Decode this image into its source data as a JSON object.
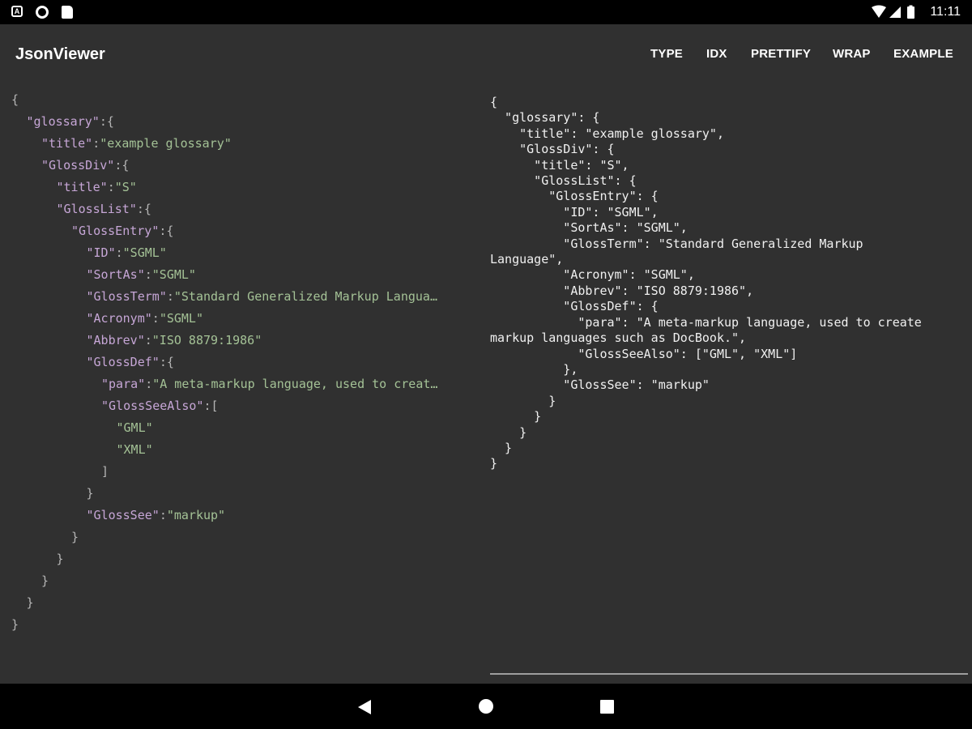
{
  "status_bar": {
    "time": "11:11",
    "left_icons": [
      "a-notification-icon",
      "circle-notification-icon",
      "sd-card-icon"
    ],
    "right_icons": [
      "wifi-icon",
      "signal-icon",
      "battery-icon"
    ]
  },
  "app_bar": {
    "title": "JsonViewer",
    "menu": [
      "TYPE",
      "IDX",
      "PRETTIFY",
      "WRAP",
      "EXAMPLE"
    ]
  },
  "tree_view": {
    "rows": [
      {
        "indent": 0,
        "segments": [
          [
            "p",
            "{"
          ]
        ]
      },
      {
        "indent": 1,
        "segments": [
          [
            "k",
            "\"glossary\""
          ],
          [
            "p",
            ":{"
          ]
        ]
      },
      {
        "indent": 2,
        "segments": [
          [
            "k",
            "\"title\""
          ],
          [
            "p",
            ":"
          ],
          [
            "v",
            "\"example glossary\""
          ]
        ]
      },
      {
        "indent": 2,
        "segments": [
          [
            "k",
            "\"GlossDiv\""
          ],
          [
            "p",
            ":{"
          ]
        ]
      },
      {
        "indent": 3,
        "segments": [
          [
            "k",
            "\"title\""
          ],
          [
            "p",
            ":"
          ],
          [
            "v",
            "\"S\""
          ]
        ]
      },
      {
        "indent": 3,
        "segments": [
          [
            "k",
            "\"GlossList\""
          ],
          [
            "p",
            ":{"
          ]
        ]
      },
      {
        "indent": 4,
        "segments": [
          [
            "k",
            "\"GlossEntry\""
          ],
          [
            "p",
            ":{"
          ]
        ]
      },
      {
        "indent": 5,
        "segments": [
          [
            "k",
            "\"ID\""
          ],
          [
            "p",
            ":"
          ],
          [
            "v",
            "\"SGML\""
          ]
        ]
      },
      {
        "indent": 5,
        "segments": [
          [
            "k",
            "\"SortAs\""
          ],
          [
            "p",
            ":"
          ],
          [
            "v",
            "\"SGML\""
          ]
        ]
      },
      {
        "indent": 5,
        "segments": [
          [
            "k",
            "\"GlossTerm\""
          ],
          [
            "p",
            ":"
          ],
          [
            "v",
            "\"Standard Generalized Markup Langua…"
          ]
        ]
      },
      {
        "indent": 5,
        "segments": [
          [
            "k",
            "\"Acronym\""
          ],
          [
            "p",
            ":"
          ],
          [
            "v",
            "\"SGML\""
          ]
        ]
      },
      {
        "indent": 5,
        "segments": [
          [
            "k",
            "\"Abbrev\""
          ],
          [
            "p",
            ":"
          ],
          [
            "v",
            "\"ISO 8879:1986\""
          ]
        ]
      },
      {
        "indent": 5,
        "segments": [
          [
            "k",
            "\"GlossDef\""
          ],
          [
            "p",
            ":{"
          ]
        ]
      },
      {
        "indent": 6,
        "segments": [
          [
            "k",
            "\"para\""
          ],
          [
            "p",
            ":"
          ],
          [
            "v",
            "\"A meta-markup language, used to creat…"
          ]
        ]
      },
      {
        "indent": 6,
        "segments": [
          [
            "k",
            "\"GlossSeeAlso\""
          ],
          [
            "p",
            ":["
          ]
        ]
      },
      {
        "indent": 7,
        "segments": [
          [
            "v",
            "\"GML\""
          ]
        ]
      },
      {
        "indent": 7,
        "segments": [
          [
            "v",
            "\"XML\""
          ]
        ]
      },
      {
        "indent": 6,
        "segments": [
          [
            "p",
            "]"
          ]
        ]
      },
      {
        "indent": 5,
        "segments": [
          [
            "p",
            "}"
          ]
        ]
      },
      {
        "indent": 5,
        "segments": [
          [
            "k",
            "\"GlossSee\""
          ],
          [
            "p",
            ":"
          ],
          [
            "v",
            "\"markup\""
          ]
        ]
      },
      {
        "indent": 4,
        "segments": [
          [
            "p",
            "}"
          ]
        ]
      },
      {
        "indent": 3,
        "segments": [
          [
            "p",
            "}"
          ]
        ]
      },
      {
        "indent": 2,
        "segments": [
          [
            "p",
            "}"
          ]
        ]
      },
      {
        "indent": 1,
        "segments": [
          [
            "p",
            "}"
          ]
        ]
      },
      {
        "indent": 0,
        "segments": [
          [
            "p",
            "}"
          ]
        ]
      }
    ]
  },
  "pretty_view": {
    "lines": [
      "{",
      "  \"glossary\": {",
      "    \"title\": \"example glossary\",",
      "    \"GlossDiv\": {",
      "      \"title\": \"S\",",
      "      \"GlossList\": {",
      "        \"GlossEntry\": {",
      "          \"ID\": \"SGML\",",
      "          \"SortAs\": \"SGML\",",
      "          \"GlossTerm\": \"Standard Generalized Markup",
      "Language\",",
      "          \"Acronym\": \"SGML\",",
      "          \"Abbrev\": \"ISO 8879:1986\",",
      "          \"GlossDef\": {",
      "            \"para\": \"A meta-markup language, used to create",
      "markup languages such as DocBook.\",",
      "            \"GlossSeeAlso\": [\"GML\", \"XML\"]",
      "          },",
      "          \"GlossSee\": \"markup\"",
      "        }",
      "      }",
      "    }",
      "  }",
      "}"
    ]
  },
  "nav_bar": {
    "buttons": [
      "back-icon",
      "home-icon",
      "recents-icon"
    ]
  }
}
